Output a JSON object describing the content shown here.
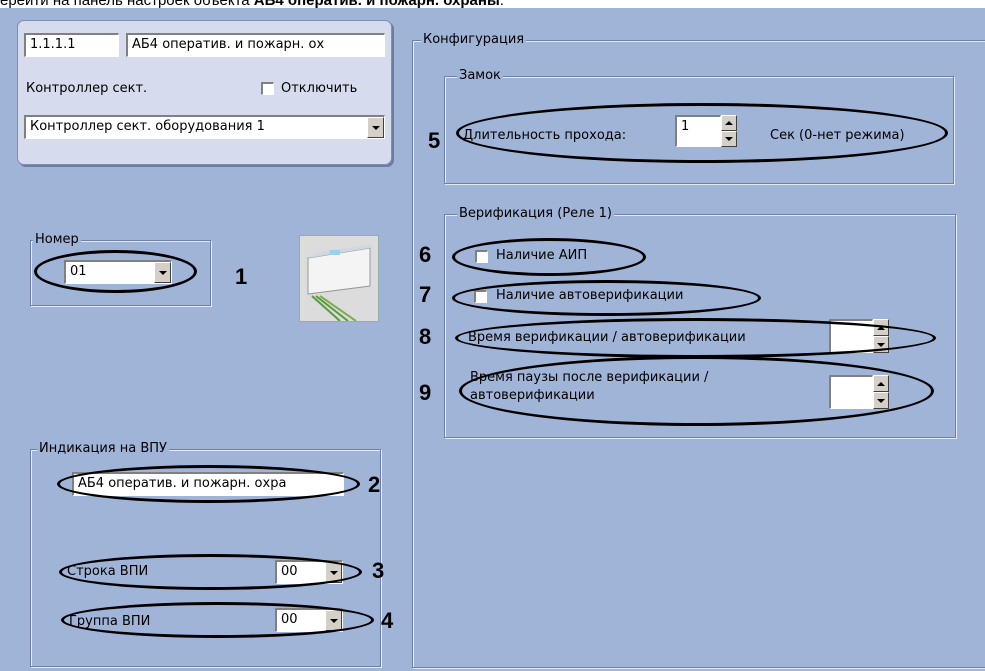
{
  "caption": {
    "prefix": "ерейти на панель настроек объекта ",
    "bold": "АБ4 оператив. и пожарн. охраны",
    "suffix": "."
  },
  "header": {
    "object_id": "1.1.1.1",
    "object_name": "АБ4 оператив. и пожарн. ох",
    "parent_label": "Контроллер сект.",
    "disable_label": "Отключить",
    "parent_value": "Контроллер сект. оборудования 1"
  },
  "number_group": {
    "legend": "Номер",
    "value": "01"
  },
  "vpu_group": {
    "legend": "Индикация на ВПУ",
    "name_value": "АБ4 оператив. и пожарн. охра",
    "row_label": "Строка ВПИ",
    "row_value": "00",
    "group_label": "Группа ВПИ",
    "group_value": "00"
  },
  "config_group": {
    "legend": "Конфигурация",
    "lock": {
      "legend": "Замок",
      "pass_label": "Длительность прохода:",
      "pass_value": "1",
      "pass_unit": "Сек (0-нет режима)"
    },
    "verification": {
      "legend": "Верификация (Реле 1)",
      "aip_label": "Наличие АИП",
      "autover_label": "Наличие автоверификации",
      "time_label": "Время верификации / автоверификации",
      "time_value": "",
      "pause_label_line1": "Время паузы после верификации /",
      "pause_label_line2": "автоверификации",
      "pause_value": ""
    }
  },
  "callouts": [
    "1",
    "2",
    "3",
    "4",
    "5",
    "6",
    "7",
    "8",
    "9"
  ],
  "colors": {
    "panel_bg": "#a0b4d8",
    "header_bg": "#d6dced"
  }
}
